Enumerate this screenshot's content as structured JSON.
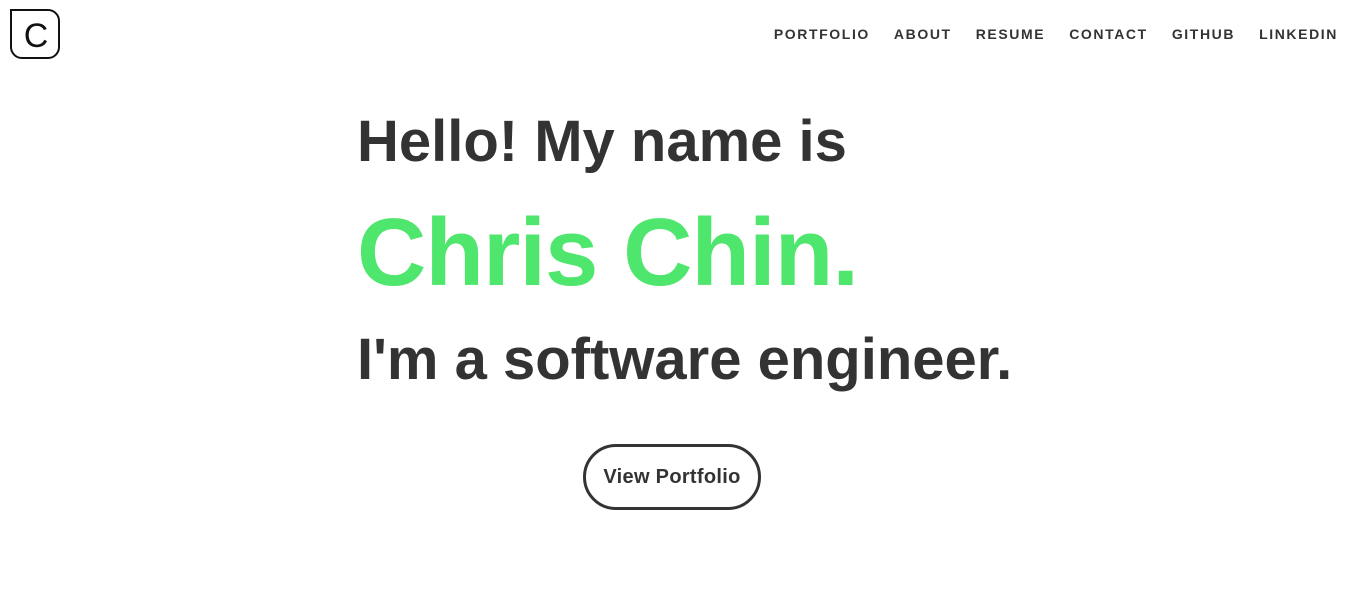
{
  "logo": {
    "letter": "C"
  },
  "nav": {
    "items": [
      {
        "label": "PORTFOLIO"
      },
      {
        "label": "ABOUT"
      },
      {
        "label": "RESUME"
      },
      {
        "label": "CONTACT"
      },
      {
        "label": "GITHUB"
      },
      {
        "label": "LINKEDIN"
      }
    ]
  },
  "hero": {
    "greeting": "Hello! My name is",
    "name": "Chris Chin.",
    "role": "I'm a software engineer.",
    "cta_label": "View Portfolio"
  },
  "colors": {
    "accent": "#4ee66c",
    "text": "#333333",
    "background": "#ffffff"
  }
}
